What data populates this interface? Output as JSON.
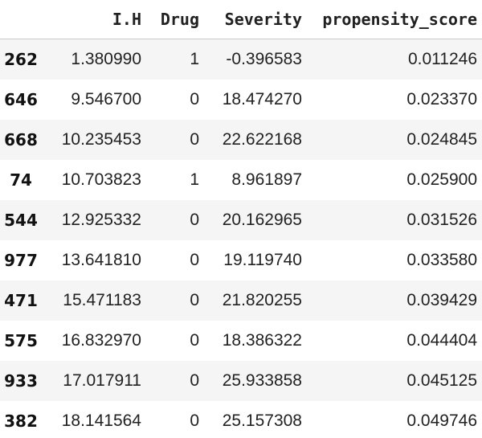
{
  "table": {
    "columns": [
      "",
      "I.H",
      "Drug",
      "Severity",
      "propensity_score"
    ],
    "rows": [
      {
        "index": "262",
        "ih": "1.380990",
        "drug": "1",
        "severity": "-0.396583",
        "propensity_score": "0.011246"
      },
      {
        "index": "646",
        "ih": "9.546700",
        "drug": "0",
        "severity": "18.474270",
        "propensity_score": "0.023370"
      },
      {
        "index": "668",
        "ih": "10.235453",
        "drug": "0",
        "severity": "22.622168",
        "propensity_score": "0.024845"
      },
      {
        "index": "74",
        "ih": "10.703823",
        "drug": "1",
        "severity": "8.961897",
        "propensity_score": "0.025900"
      },
      {
        "index": "544",
        "ih": "12.925332",
        "drug": "0",
        "severity": "20.162965",
        "propensity_score": "0.031526"
      },
      {
        "index": "977",
        "ih": "13.641810",
        "drug": "0",
        "severity": "19.119740",
        "propensity_score": "0.033580"
      },
      {
        "index": "471",
        "ih": "15.471183",
        "drug": "0",
        "severity": "21.820255",
        "propensity_score": "0.039429"
      },
      {
        "index": "575",
        "ih": "16.832970",
        "drug": "0",
        "severity": "18.386322",
        "propensity_score": "0.044404"
      },
      {
        "index": "933",
        "ih": "17.017911",
        "drug": "0",
        "severity": "25.933858",
        "propensity_score": "0.045125"
      },
      {
        "index": "382",
        "ih": "18.141564",
        "drug": "0",
        "severity": "25.157308",
        "propensity_score": "0.049746"
      }
    ]
  }
}
